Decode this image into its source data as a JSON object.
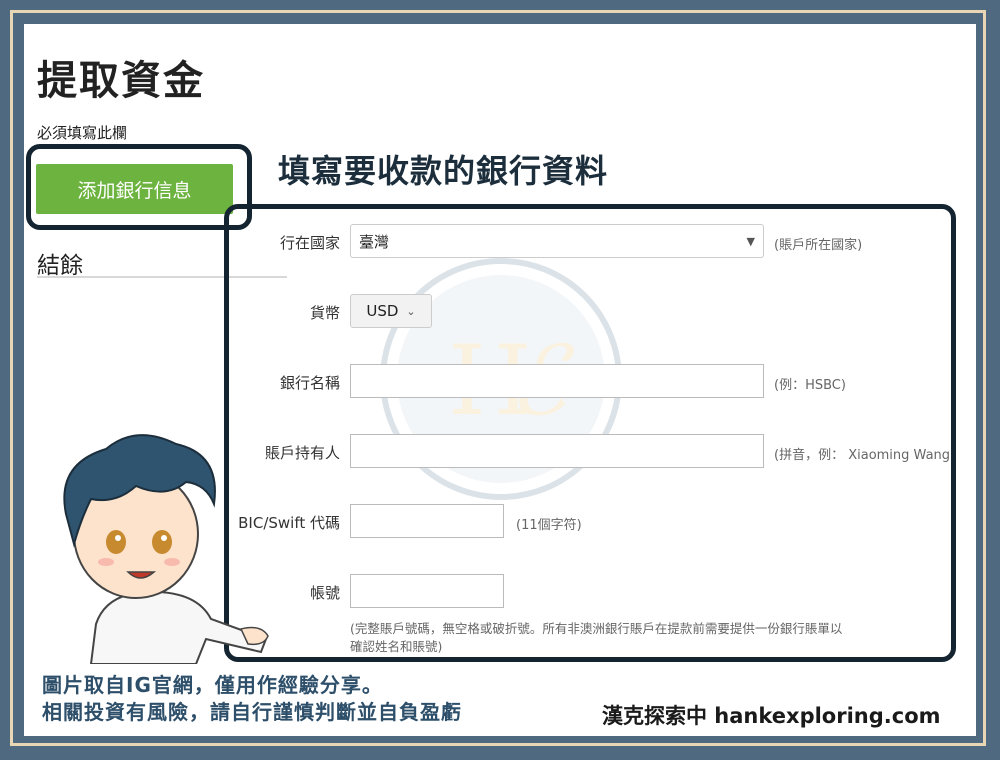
{
  "page": {
    "title": "提取資金",
    "required_note": "必須填寫此欄",
    "add_bank_button": "添加銀行信息",
    "balance_heading": "結餘"
  },
  "annotation": "填寫要收款的銀行資料",
  "form": {
    "country": {
      "label": "行在國家",
      "value": "臺灣",
      "hint": "(賬戶所在國家)"
    },
    "currency": {
      "label": "貨幣",
      "value": "USD"
    },
    "bank_name": {
      "label": "銀行名稱",
      "value": "",
      "hint": "(例：HSBC)"
    },
    "account_holder": {
      "label": "賬戶持有人",
      "value": "",
      "hint": "(拼音，例： Xiaoming Wang)"
    },
    "bic_swift": {
      "label": "BIC/Swift 代碼",
      "value": "",
      "hint": "(11個字符)"
    },
    "account_number": {
      "label": "帳號",
      "value": "",
      "hint_line1": "(完整賬戶號碼，無空格或破折號。所有非澳洲銀行賬戶在提款前需要提供一份銀行賬單以",
      "hint_line2": "確認姓名和賬號)"
    }
  },
  "footer": {
    "disclaimer_line1": "圖片取自IG官網，僅用作經驗分享。",
    "disclaimer_line2": "相關投資有風險，請自行謹慎判斷並自負盈虧",
    "brand": "漢克探索中 hankexploring.com"
  },
  "colors": {
    "frame": "#4f6a80",
    "frame_border": "#e9d6b4",
    "button_green": "#6cb33f",
    "highlight_box": "#142430",
    "disclaimer_text": "#2e4f6a"
  },
  "icons": {
    "watermark": "he-logo-watermark",
    "mascot": "mascot-illustration",
    "dropdown": "chevron-down-icon"
  }
}
